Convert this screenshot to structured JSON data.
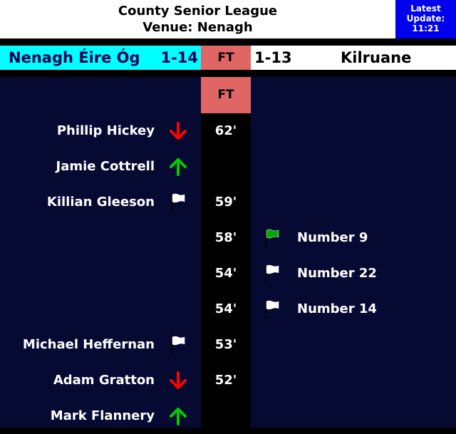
{
  "header": {
    "competition": "County Senior League",
    "venue": "Venue: Nenagh",
    "update_label_1": "Latest",
    "update_label_2": "Update:",
    "update_time": "11:21"
  },
  "scoreboard": {
    "home_team": "Nenagh Éire Óg",
    "home_score": "1-14",
    "status": "FT",
    "away_score": "1-13",
    "away_team": "Kilruane"
  },
  "timeline": {
    "status": "FT",
    "events": [
      {
        "side": "home",
        "player": "Phillip Hickey",
        "icon": "sub-off-arrow-icon",
        "minute": "62'"
      },
      {
        "side": "home",
        "player": "Jamie Cottrell",
        "icon": "sub-on-arrow-icon",
        "minute": ""
      },
      {
        "side": "home",
        "player": "Killian Gleeson",
        "icon": "white-flag-icon",
        "minute": "59'"
      },
      {
        "side": "away",
        "player": "Number 9",
        "icon": "green-flag-icon",
        "minute": "58'"
      },
      {
        "side": "away",
        "player": "Number 22",
        "icon": "white-flag-icon",
        "minute": "54'"
      },
      {
        "side": "away",
        "player": "Number 14",
        "icon": "white-flag-icon",
        "minute": "54'"
      },
      {
        "side": "home",
        "player": "Michael Heffernan",
        "icon": "white-flag-icon",
        "minute": "53'"
      },
      {
        "side": "home",
        "player": "Adam Gratton",
        "icon": "sub-off-arrow-icon",
        "minute": "52'"
      },
      {
        "side": "home",
        "player": "Mark Flannery",
        "icon": "sub-on-arrow-icon",
        "minute": ""
      }
    ]
  },
  "colors": {
    "home_bg": "#00ffff",
    "status_bg": "#e06666",
    "update_bg": "#0000ee",
    "timeline_bg": "#060a33",
    "sub_off": "#ff0000",
    "sub_on": "#00cc00",
    "green_flag": "#00aa00",
    "white_flag": "#ffffff"
  }
}
